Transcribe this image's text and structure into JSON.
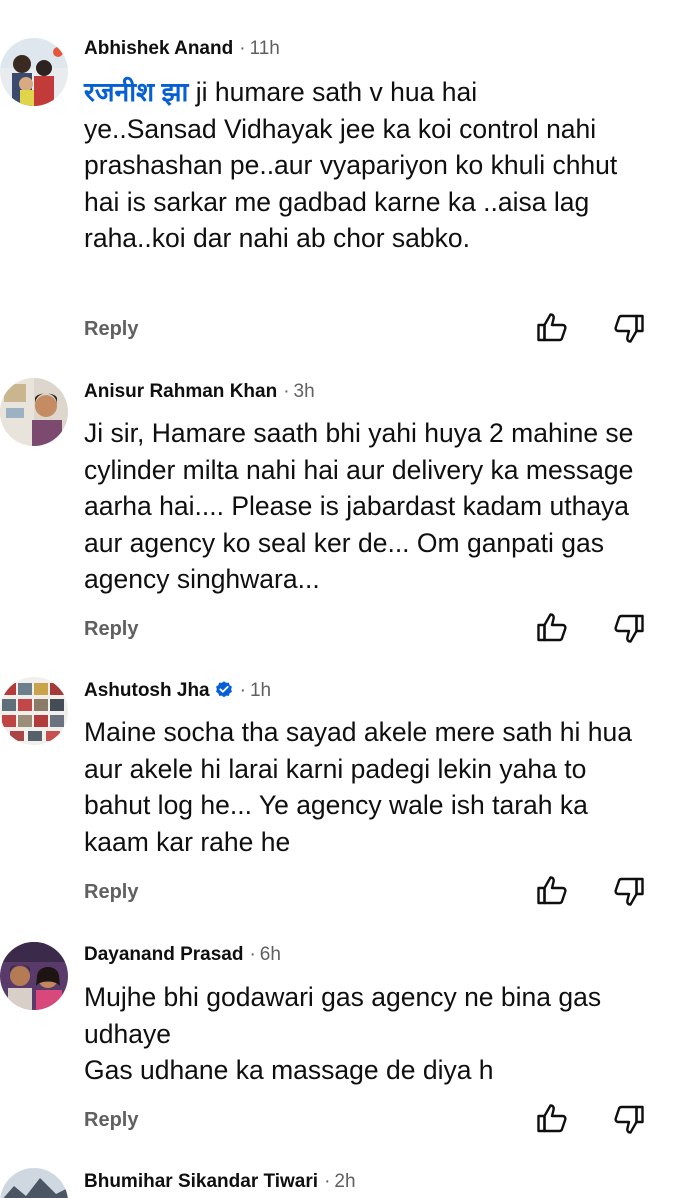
{
  "comments": [
    {
      "author": "Abhishek Anand",
      "time": "11h",
      "mention": "रजनीश झा",
      "text": " ji humare sath v hua hai\nye..Sansad Vidhayak jee ka koi control nahi prashashan pe..aur vyapariyon ko khuli chhut hai is sarkar me gadbad karne ka ..aisa lag raha..koi dar nahi ab chor sabko.",
      "reply_label": "Reply"
    },
    {
      "author": "Anisur Rahman Khan",
      "time": "3h",
      "text": "Ji sir, Hamare saath bhi yahi huya 2 mahine se cylinder milta nahi hai aur delivery ka message aarha hai.... Please is jabardast kadam uthaya aur agency ko seal ker de... Om ganpati gas agency singhwara...",
      "reply_label": "Reply"
    },
    {
      "author": "Ashutosh Jha",
      "time": "1h",
      "verified": true,
      "text": "Maine socha tha sayad akele mere sath hi hua aur akele hi larai karni padegi lekin yaha to bahut log he... Ye agency wale ish tarah ka kaam kar rahe he",
      "reply_label": "Reply"
    },
    {
      "author": "Dayanand Prasad",
      "time": "6h",
      "text": "Mujhe bhi godawari gas agency ne bina gas udhaye\nGas udhane ka massage de diya h",
      "reply_label": "Reply"
    },
    {
      "author": "Bhumihar Sikandar Tiwari",
      "time": "2h"
    }
  ],
  "colors": {
    "author": "#0f0f0f",
    "meta": "#606060",
    "mention": "#065fd4",
    "verified": "#065fd4"
  },
  "icons": {
    "like": "thumbs-up-icon",
    "dislike": "thumbs-down-icon",
    "verified": "verified-badge-icon"
  }
}
